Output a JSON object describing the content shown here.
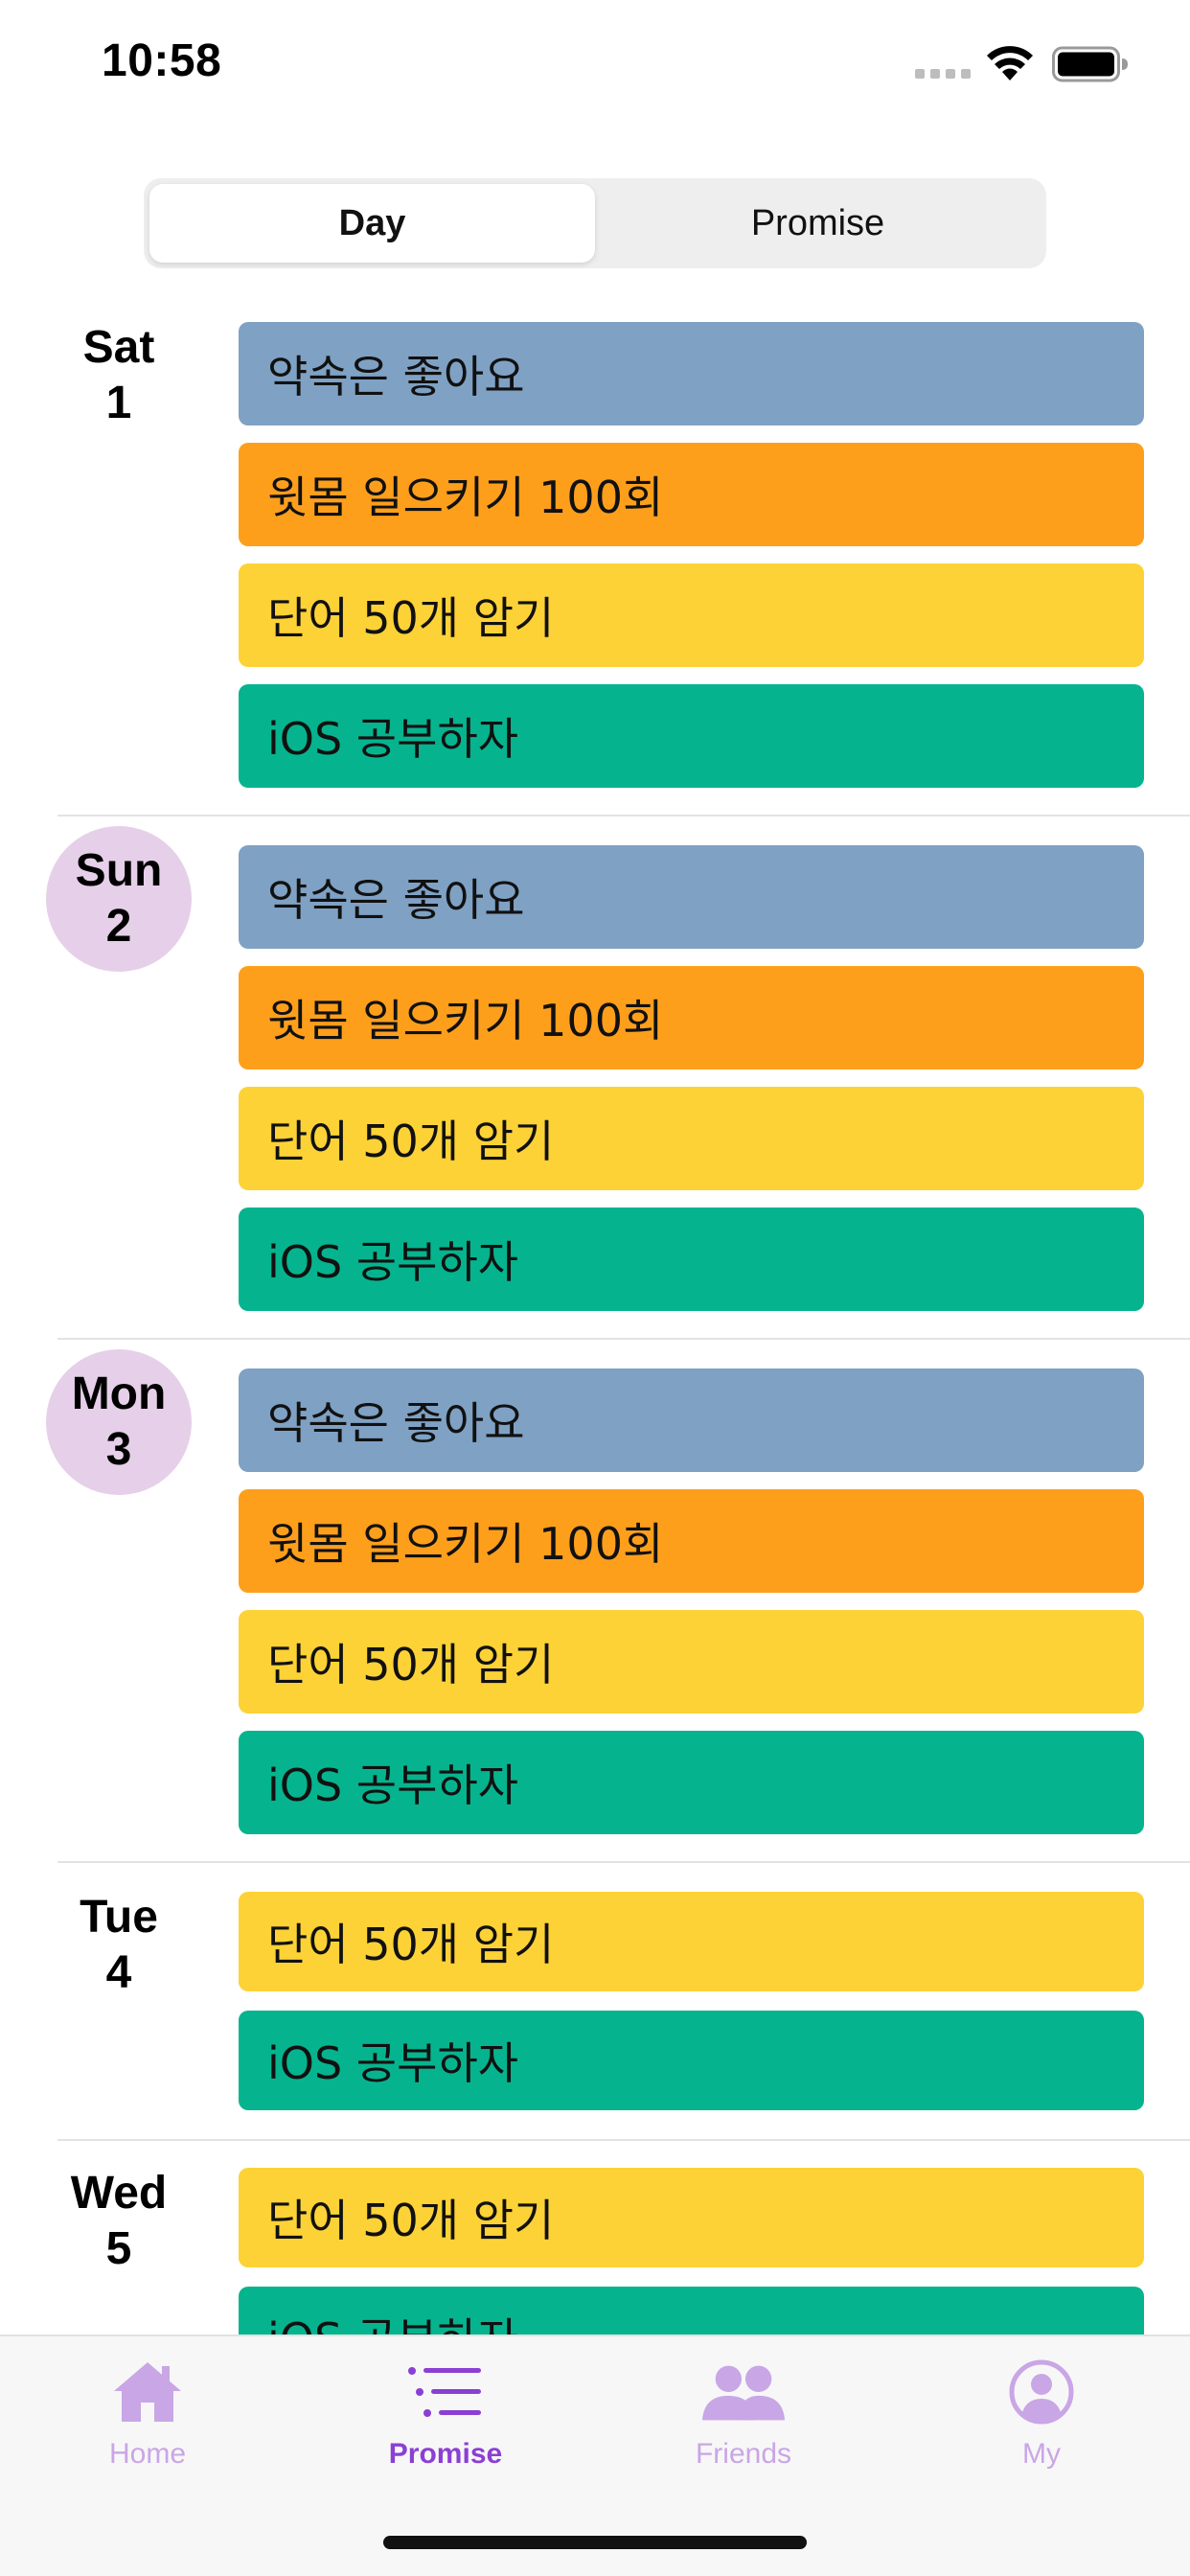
{
  "status": {
    "time": "10:58"
  },
  "segments": [
    {
      "label": "Day",
      "selected": true
    },
    {
      "label": "Promise",
      "selected": false
    }
  ],
  "colors": {
    "blue": "#7fa1c4",
    "orange": "#fe9f1c",
    "yellow": "#fdd236",
    "green": "#05b48e",
    "today_circle": "#e6cfe8",
    "tab_active": "#8b3fd4",
    "tab_inactive": "#c9a6e6"
  },
  "days": [
    {
      "weekday": "Sat",
      "day": "1",
      "circled": false,
      "promises": [
        {
          "title": "약속은 좋아요",
          "color": "#7fa1c4"
        },
        {
          "title": "윗몸 일으키기 100회",
          "color": "#fe9f1c"
        },
        {
          "title": "단어 50개 암기",
          "color": "#fdd236"
        },
        {
          "title": "iOS 공부하자",
          "color": "#05b48e"
        }
      ]
    },
    {
      "weekday": "Sun",
      "day": "2",
      "circled": true,
      "promises": [
        {
          "title": "약속은 좋아요",
          "color": "#7fa1c4"
        },
        {
          "title": "윗몸 일으키기 100회",
          "color": "#fe9f1c"
        },
        {
          "title": "단어 50개 암기",
          "color": "#fdd236"
        },
        {
          "title": "iOS 공부하자",
          "color": "#05b48e"
        }
      ]
    },
    {
      "weekday": "Mon",
      "day": "3",
      "circled": true,
      "promises": [
        {
          "title": "약속은 좋아요",
          "color": "#7fa1c4"
        },
        {
          "title": "윗몸 일으키기 100회",
          "color": "#fe9f1c"
        },
        {
          "title": "단어 50개 암기",
          "color": "#fdd236"
        },
        {
          "title": "iOS 공부하자",
          "color": "#05b48e"
        }
      ]
    },
    {
      "weekday": "Tue",
      "day": "4",
      "circled": false,
      "promises": [
        {
          "title": "단어 50개 암기",
          "color": "#fdd236"
        },
        {
          "title": "iOS 공부하자",
          "color": "#05b48e"
        }
      ]
    },
    {
      "weekday": "Wed",
      "day": "5",
      "circled": false,
      "promises": [
        {
          "title": "단어 50개 암기",
          "color": "#fdd236"
        },
        {
          "title": "iOS 공부하자",
          "color": "#05b48e"
        }
      ]
    }
  ],
  "tabs": [
    {
      "label": "Home",
      "icon": "house-icon",
      "active": false
    },
    {
      "label": "Promise",
      "icon": "list-icon",
      "active": true
    },
    {
      "label": "Friends",
      "icon": "people-icon",
      "active": false
    },
    {
      "label": "My",
      "icon": "person-circle-icon",
      "active": false
    }
  ]
}
